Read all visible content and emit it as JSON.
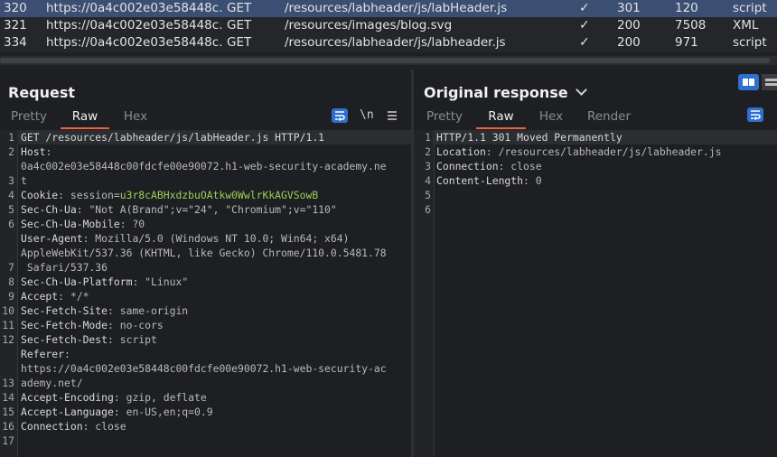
{
  "history": {
    "rows": [
      {
        "id": "320",
        "host": "https://0a4c002e03e58448c...",
        "method": "GET",
        "url": "/resources/labheader/js/labHeader.js",
        "edited": "✓",
        "status": "301",
        "length": "120",
        "mime": "script",
        "selected": true
      },
      {
        "id": "321",
        "host": "https://0a4c002e03e58448c...",
        "method": "GET",
        "url": "/resources/images/blog.svg",
        "edited": "✓",
        "status": "200",
        "length": "7508",
        "mime": "XML",
        "selected": false
      },
      {
        "id": "334",
        "host": "https://0a4c002e03e58448c...",
        "method": "GET",
        "url": "/resources/labheader/js/labheader.js",
        "edited": "✓",
        "status": "200",
        "length": "971",
        "mime": "script",
        "selected": false
      }
    ]
  },
  "request": {
    "title": "Request",
    "tabs": [
      "Pretty",
      "Raw",
      "Hex"
    ],
    "active_tab": "Raw",
    "icons": [
      "wrap-lines-icon",
      "newline-icon",
      "menu-icon"
    ],
    "newline_label": "\\n",
    "line_numbers": [
      "1",
      "2",
      "",
      "3",
      "4",
      "5",
      "6",
      "",
      "",
      "7",
      "8",
      "9",
      "10",
      "11",
      "12",
      "",
      "",
      "13",
      "14",
      "15",
      "16",
      "17"
    ],
    "lines": [
      {
        "k": "GET /resources/labheader/js/labHeader.js HTTP/1.1",
        "v": "",
        "highlight": true
      },
      {
        "k": "Host",
        "v": ":"
      },
      {
        "k": "",
        "v": "0a4c002e03e58448c00fdcfe00e90072.h1-web-security-academy.ne"
      },
      {
        "k": "",
        "v": "t"
      },
      {
        "k": "Cookie",
        "v": ": session=",
        "c": "u3r8cABHxdzbuOAtkw0WwlrKkAGVSowB"
      },
      {
        "k": "Sec-Ch-Ua",
        "v": ": \"Not A(Brand\";v=\"24\", \"Chromium\";v=\"110\""
      },
      {
        "k": "Sec-Ch-Ua-Mobile",
        "v": ": ?0"
      },
      {
        "k": "User-Agent",
        "v": ": Mozilla/5.0 (Windows NT 10.0; Win64; x64)"
      },
      {
        "k": "",
        "v": "AppleWebKit/537.36 (KHTML, like Gecko) Chrome/110.0.5481.78"
      },
      {
        "k": "",
        "v": " Safari/537.36"
      },
      {
        "k": "Sec-Ch-Ua-Platform",
        "v": ": \"Linux\""
      },
      {
        "k": "Accept",
        "v": ": */*"
      },
      {
        "k": "Sec-Fetch-Site",
        "v": ": same-origin"
      },
      {
        "k": "Sec-Fetch-Mode",
        "v": ": no-cors"
      },
      {
        "k": "Sec-Fetch-Dest",
        "v": ": script"
      },
      {
        "k": "Referer",
        "v": ":"
      },
      {
        "k": "",
        "v": "https://0a4c002e03e58448c00fdcfe00e90072.h1-web-security-ac"
      },
      {
        "k": "",
        "v": "ademy.net/"
      },
      {
        "k": "Accept-Encoding",
        "v": ": gzip, deflate"
      },
      {
        "k": "Accept-Language",
        "v": ": en-US,en;q=0.9"
      },
      {
        "k": "Connection",
        "v": ": close"
      },
      {
        "k": "",
        "v": ""
      },
      {
        "k": "",
        "v": ""
      }
    ]
  },
  "response": {
    "title": "Original response",
    "tabs": [
      "Pretty",
      "Raw",
      "Hex",
      "Render"
    ],
    "active_tab": "Raw",
    "line_numbers": [
      "1",
      "2",
      "3",
      "4",
      "5",
      "6"
    ],
    "lines": [
      {
        "k": "HTTP/1.1 301 Moved Permanently",
        "v": "",
        "highlight": true
      },
      {
        "k": "Location",
        "v": ": /resources/labheader/js/labheader.js"
      },
      {
        "k": "Connection",
        "v": ": close"
      },
      {
        "k": "Content-Length",
        "v": ": 0"
      },
      {
        "k": "",
        "v": ""
      },
      {
        "k": "",
        "v": ""
      }
    ]
  },
  "colors": {
    "accent": "#e8643c",
    "selected_row": "#3b4f73",
    "button_blue": "#2f6fd0",
    "cookie_value": "#9ccf5a"
  }
}
